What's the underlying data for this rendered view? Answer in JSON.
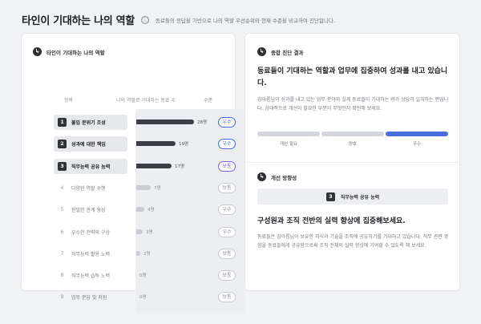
{
  "header": {
    "title": "타인이 기대하는 나의 역할",
    "info_icon": "ⓘ",
    "description": "동료들의 응답을 기반으로 나의 역할 우선순위와 현재 수준을 비교하여 진단합니다."
  },
  "left_card": {
    "section_title": "타인이 기대하는 나의 역할",
    "columns": [
      "항목",
      "나의 역할로 기대하는 동료 수",
      "수준"
    ],
    "rows": [
      {
        "rank": "1",
        "label": "불입 분위기 조성",
        "count": 28,
        "count_text": "28명",
        "level": "우수",
        "level_type": "good",
        "top": true
      },
      {
        "rank": "2",
        "label": "성과에 대한 책임",
        "count": 19,
        "count_text": "19명",
        "level": "우수",
        "level_type": "good",
        "top": true
      },
      {
        "rank": "3",
        "label": "직무능력 공유 능력",
        "count": 17,
        "count_text": "17명",
        "level": "보통",
        "level_type": "mid",
        "top": true
      },
      {
        "rank": "4",
        "label": "다양한 역할 수행",
        "count": 7,
        "count_text": "7명",
        "level": "보통",
        "level_type": "plain",
        "top": false
      },
      {
        "rank": "5",
        "label": "친밀한 관계 형성",
        "count": 4,
        "count_text": "4명",
        "level": "우수",
        "level_type": "plain",
        "top": false
      },
      {
        "rank": "6",
        "label": "우수한 전략의 구상",
        "count": 3,
        "count_text": "3명",
        "level": "우수",
        "level_type": "plain",
        "top": false
      },
      {
        "rank": "7",
        "label": "직무능력 활용 노력",
        "count": 2,
        "count_text": "2명",
        "level": "보통",
        "level_type": "plain",
        "top": false
      },
      {
        "rank": "8",
        "label": "직무능력 습득 노력",
        "count": 0,
        "count_text": "0명",
        "level": "보통",
        "level_type": "plain",
        "top": false
      },
      {
        "rank": "9",
        "label": "업무 분담 및 지원",
        "count": 0,
        "count_text": "0명",
        "level": "보통",
        "level_type": "plain",
        "top": false
      }
    ],
    "max_count": 28
  },
  "right_card": {
    "section_title": "종합 진단 결과",
    "diagnosis_title": "동료들이 기대하는 역할과 업무에 집중하여 성과를 내고 있습니다.",
    "diagnosis_desc": "김아름님이 성과를 내고 있는 업무 분야와 실제 동료들이 기대하는 바가 상당히 일치하는 편입니다. 상대적으로 개선이 필요한 부분이 무엇인지 확인해 보세요.",
    "scale": [
      {
        "label": "개선 필요",
        "active": false
      },
      {
        "label": "양호",
        "active": false
      },
      {
        "label": "우수",
        "active": true
      }
    ],
    "direction_title": "개선 방향성",
    "focus_rank": "3",
    "focus_label": "직무능력 공유 능력",
    "focus_title": "구성원과 조직 전반의 실력 향상에 집중해보세요.",
    "focus_desc": "동료들은 김아름님이 보유한 지식과 기술을 조직에 공유하기를 기대하고 있습니다. 직무 관련 경험을 동료들에게 공유함으로써 조직 전체의 실력 향상에 기여할 수 있도록 해 보세요."
  },
  "colors": {
    "accent_blue": "#4a6de2",
    "badge_good": "#3f6fd8",
    "badge_mid": "#7d5fd6",
    "bar_dark": "#3b3f45",
    "bar_light": "#c9ccd1"
  },
  "icons": {
    "section_icon": "chat-bubble-icon"
  }
}
